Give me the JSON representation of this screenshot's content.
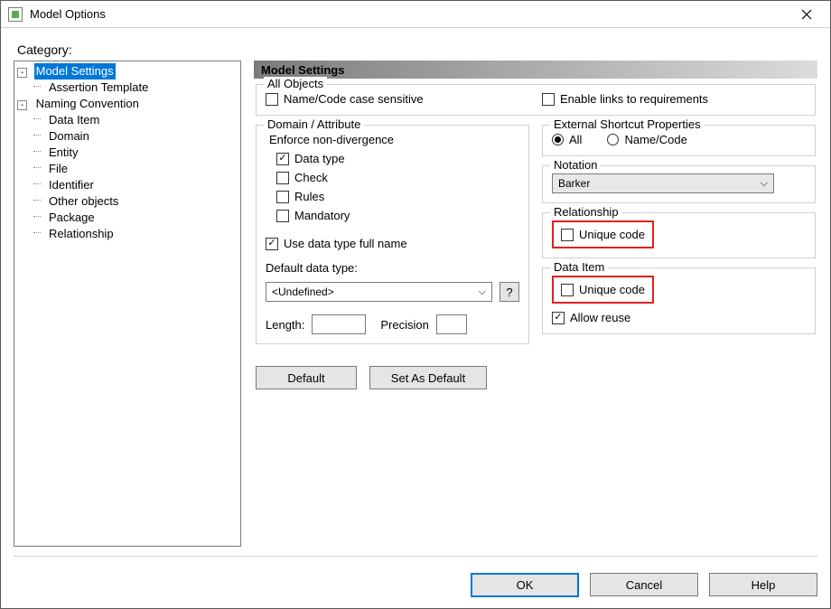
{
  "window": {
    "title": "Model Options"
  },
  "category_label": "Category:",
  "tree": {
    "root": [
      {
        "label": "Model Settings",
        "toggle": "-",
        "selected": true,
        "children": [
          {
            "label": "Assertion Template"
          }
        ]
      },
      {
        "label": "Naming Convention",
        "toggle": "-",
        "selected": false,
        "children": [
          {
            "label": "Data Item"
          },
          {
            "label": "Domain"
          },
          {
            "label": "Entity"
          },
          {
            "label": "File"
          },
          {
            "label": "Identifier"
          },
          {
            "label": "Other objects"
          },
          {
            "label": "Package"
          },
          {
            "label": "Relationship"
          }
        ]
      }
    ]
  },
  "section_title": "Model Settings",
  "all_objects": {
    "legend": "All Objects",
    "name_code_case_sensitive": {
      "label": "Name/Code case sensitive",
      "checked": false
    },
    "enable_links_requirements": {
      "label": "Enable links to requirements",
      "checked": false
    }
  },
  "domain_attribute": {
    "legend": "Domain / Attribute",
    "enforce_label": "Enforce non-divergence",
    "data_type": {
      "label": "Data type",
      "checked": true
    },
    "check": {
      "label": "Check",
      "checked": false
    },
    "rules": {
      "label": "Rules",
      "checked": false
    },
    "mandatory": {
      "label": "Mandatory",
      "checked": false
    },
    "use_full_name": {
      "label": "Use data type full name",
      "checked": true
    },
    "default_data_type_label": "Default data type:",
    "default_data_type_value": "<Undefined>",
    "help_btn": "?",
    "length_label": "Length:",
    "precision_label": "Precision"
  },
  "ext_shortcut": {
    "legend": "External Shortcut Properties",
    "all": {
      "label": "All",
      "selected": true
    },
    "name_code": {
      "label": "Name/Code",
      "selected": false
    }
  },
  "notation": {
    "legend": "Notation",
    "value": "Barker"
  },
  "relationship": {
    "legend": "Relationship",
    "unique_code": {
      "label": "Unique code",
      "checked": false
    }
  },
  "data_item": {
    "legend": "Data Item",
    "unique_code": {
      "label": "Unique code",
      "checked": false
    },
    "allow_reuse": {
      "label": "Allow reuse",
      "checked": true
    }
  },
  "buttons": {
    "default": "Default",
    "set_as_default": "Set As Default",
    "ok": "OK",
    "cancel": "Cancel",
    "help": "Help"
  }
}
